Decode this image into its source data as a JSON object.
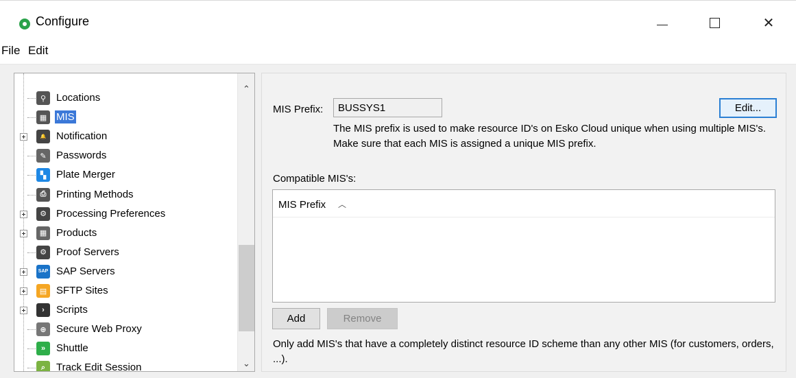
{
  "window": {
    "title": "Configure",
    "app_icon": "green-circle-icon",
    "controls": [
      "minimize",
      "maximize",
      "close"
    ],
    "close_glyph": "✕"
  },
  "menu": {
    "file": "File",
    "edit": "Edit"
  },
  "tree": {
    "items": [
      {
        "label": "Locations",
        "icon": "location-icon",
        "icon_color": "#555555",
        "expandable": false,
        "selected": false
      },
      {
        "label": "MIS",
        "icon": "mis-icon",
        "icon_color": "#555555",
        "expandable": false,
        "selected": true
      },
      {
        "label": "Notification",
        "icon": "bell-icon",
        "icon_color": "#444444",
        "expandable": true,
        "selected": false
      },
      {
        "label": "Passwords",
        "icon": "key-icon",
        "icon_color": "#666666",
        "expandable": false,
        "selected": false
      },
      {
        "label": "Plate Merger",
        "icon": "plate-merger-icon",
        "icon_color": "#1e88e5",
        "expandable": false,
        "selected": false
      },
      {
        "label": "Printing Methods",
        "icon": "printer-icon",
        "icon_color": "#555555",
        "expandable": false,
        "selected": false
      },
      {
        "label": "Processing Preferences",
        "icon": "gear-icon",
        "icon_color": "#444444",
        "expandable": true,
        "selected": false
      },
      {
        "label": "Products",
        "icon": "grid-icon",
        "icon_color": "#666666",
        "expandable": true,
        "selected": false
      },
      {
        "label": "Proof Servers",
        "icon": "proof-server-icon",
        "icon_color": "#444444",
        "expandable": false,
        "selected": false
      },
      {
        "label": "SAP Servers",
        "icon": "sap-icon",
        "icon_color": "#1a73c8",
        "expandable": true,
        "selected": false
      },
      {
        "label": "SFTP Sites",
        "icon": "sftp-icon",
        "icon_color": "#f5a623",
        "expandable": true,
        "selected": false
      },
      {
        "label": "Scripts",
        "icon": "script-icon",
        "icon_color": "#333333",
        "expandable": true,
        "selected": false
      },
      {
        "label": "Secure Web Proxy",
        "icon": "globe-icon",
        "icon_color": "#777777",
        "expandable": false,
        "selected": false
      },
      {
        "label": "Shuttle",
        "icon": "shuttle-icon",
        "icon_color": "#2eae4a",
        "expandable": false,
        "selected": false
      },
      {
        "label": "Track Edit Session",
        "icon": "search-icon",
        "icon_color": "#7cb342",
        "expandable": false,
        "selected": false
      }
    ]
  },
  "mis": {
    "prefix_label": "MIS Prefix:",
    "prefix_value": "BUSSYS1",
    "edit_button": "Edit...",
    "help_text": "The MIS prefix is used to make resource ID's on Esko Cloud unique when using multiple MIS's. Make sure that each MIS is assigned a unique MIS prefix.",
    "compatible_label": "Compatible MIS's:",
    "column_header": "MIS Prefix",
    "sort_glyph": "︿",
    "add_button": "Add",
    "remove_button": "Remove",
    "bottom_text": "Only add MIS's that have a completely distinct resource ID scheme than any other MIS (for customers, orders, ...)."
  }
}
